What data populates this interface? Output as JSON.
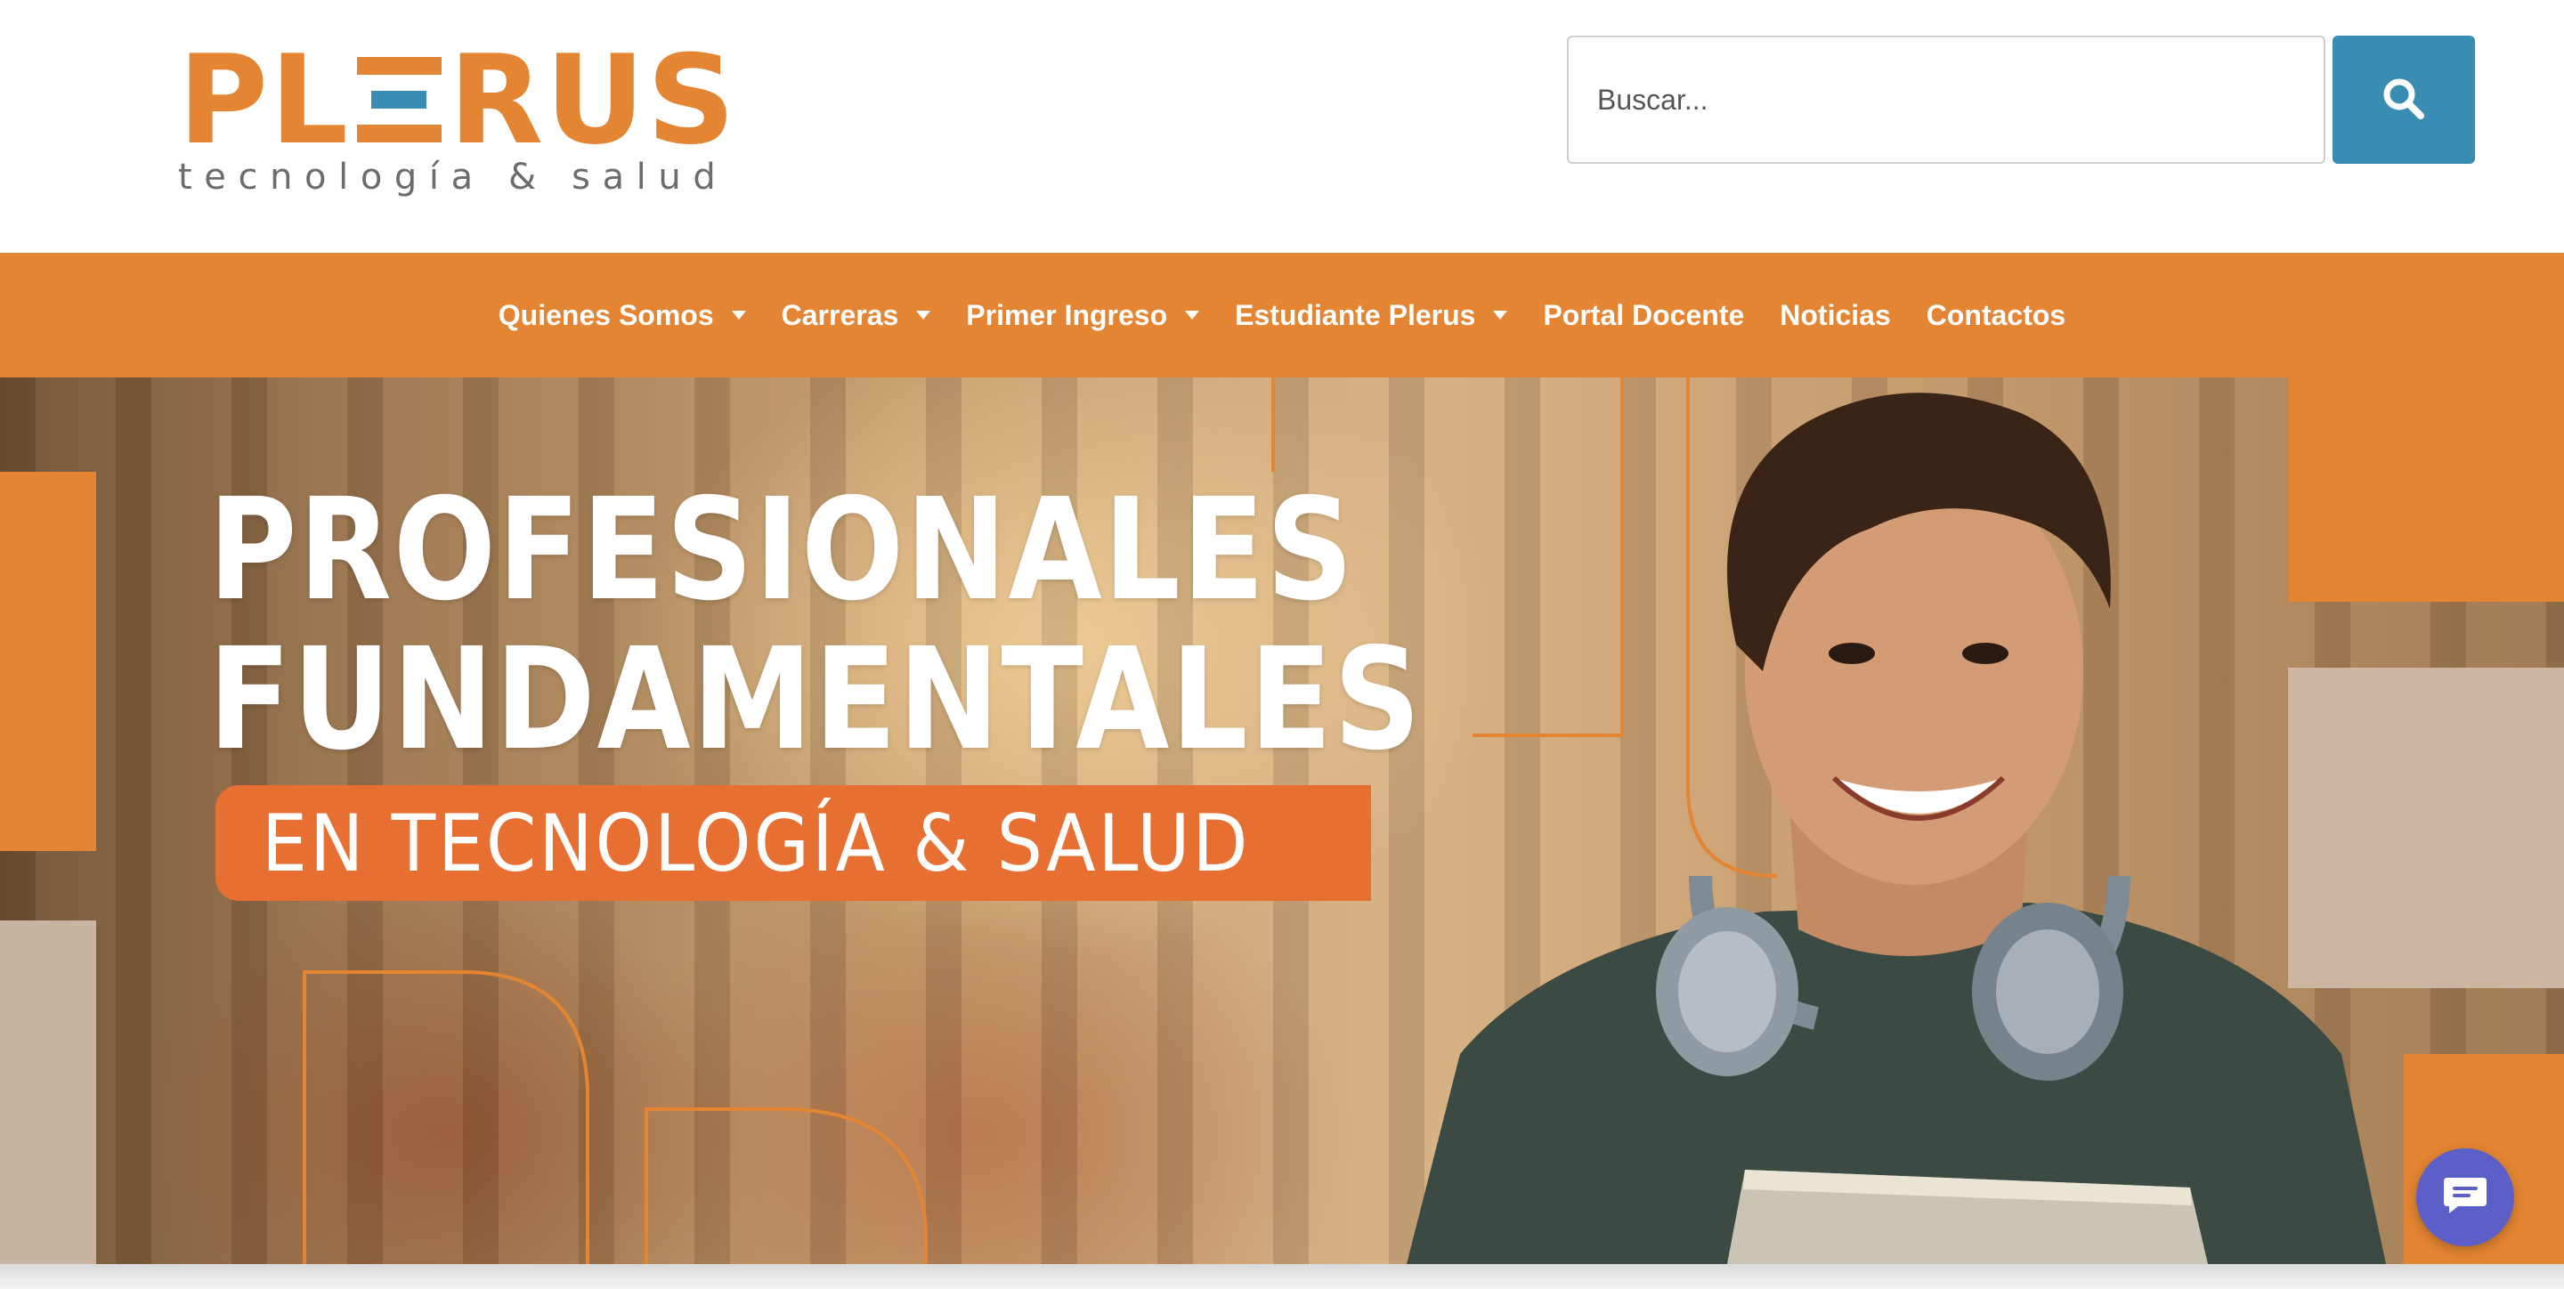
{
  "logo": {
    "letters_left": "PL",
    "letters_right": "RUS",
    "tagline": "tecnología & salud",
    "brand_orange": "#e38532",
    "brand_blue": "#3a8db2"
  },
  "search": {
    "placeholder": "Buscar...",
    "button_icon": "search-icon"
  },
  "nav": {
    "items": [
      {
        "label": "Quienes Somos",
        "has_dropdown": true
      },
      {
        "label": "Carreras",
        "has_dropdown": true
      },
      {
        "label": "Primer Ingreso",
        "has_dropdown": true
      },
      {
        "label": "Estudiante Plerus",
        "has_dropdown": true
      },
      {
        "label": "Portal Docente",
        "has_dropdown": false
      },
      {
        "label": "Noticias",
        "has_dropdown": false
      },
      {
        "label": "Contactos",
        "has_dropdown": false
      }
    ]
  },
  "hero": {
    "line1": "PROFESIONALES",
    "line2": "FUNDAMENTALES",
    "banner": "EN TECNOLOGÍA & SALUD",
    "banner_color": "#e86f32"
  },
  "chat": {
    "icon": "chat-icon",
    "color": "#5b5fc7"
  }
}
